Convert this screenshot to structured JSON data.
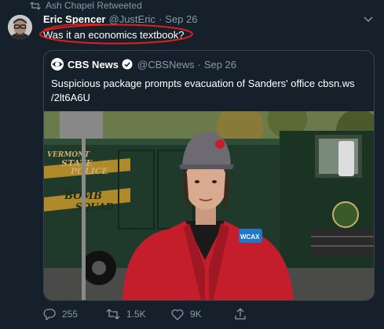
{
  "retweet": {
    "icon": "retweet-icon",
    "text": "Ash Chapel Retweeted"
  },
  "tweet": {
    "author_name": "Eric Spencer",
    "handle": "@JustEric",
    "separator": "·",
    "date": "Sep 26",
    "text": "Was it an economics textbook?",
    "avatar_icon": "avatar",
    "caret_icon": "chevron-down-icon",
    "annotation_color": "#e0201c"
  },
  "quoted": {
    "author_name": "CBS News",
    "handle": "@CBSNews",
    "separator": "·",
    "date": "Sep 26",
    "line1": "Suspicious package prompts evacuation of Sanders' office cbsn.ws",
    "line2": "/2lt6A6U",
    "logo_icon": "cbs-eye-icon",
    "verified_icon": "verified-badge-icon",
    "media": {
      "truck_lettering": [
        "VERMONT",
        "STATE",
        "POLICE",
        "BOMB",
        "SQUAD"
      ],
      "mic_flag": "WCAX"
    }
  },
  "actions": {
    "reply_count": "255",
    "retweet_count": "1.5K",
    "like_count": "9K",
    "icons": [
      "reply-icon",
      "retweet-icon",
      "like-icon",
      "share-icon"
    ]
  },
  "colors": {
    "background": "#15202b",
    "secondary_text": "#8899a6",
    "border": "#38444d",
    "accent": "#1da1f2"
  }
}
